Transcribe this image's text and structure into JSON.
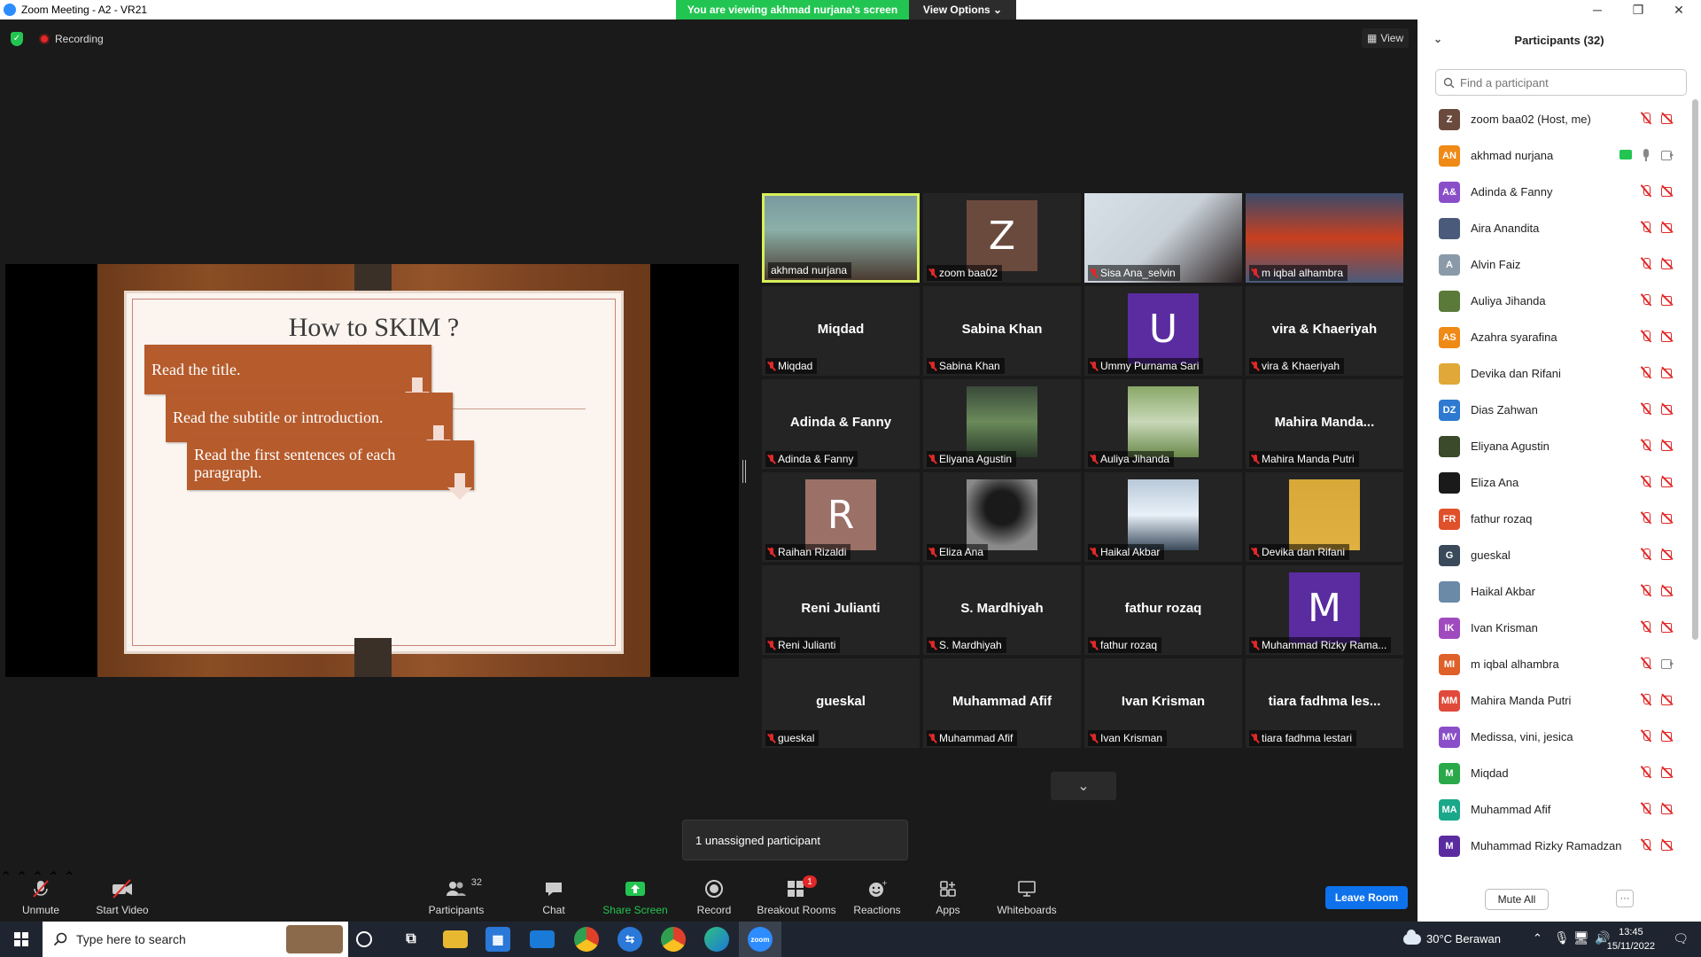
{
  "titlebar": {
    "title": "Zoom Meeting - A2 - VR21",
    "viewing_banner": "You are viewing akhmad nurjana's screen",
    "view_options": "View Options ⌄",
    "minimize": "─",
    "maximize": "❐",
    "close": "✕"
  },
  "meeting": {
    "recording_label": "Recording",
    "view_label": "View",
    "unassigned_popup": "1 unassigned participant",
    "gallery_next": "⌄"
  },
  "slide": {
    "title": "How to SKIM ?",
    "steps": [
      "Read the title.",
      "Read the subtitle or introduction.",
      "Read the first sentences of each paragraph."
    ]
  },
  "gallery": {
    "tiles": [
      {
        "label": "akhmad nurjana",
        "center": "",
        "avatar": "",
        "kind": "video"
      },
      {
        "label": "zoom baa02",
        "center": "",
        "avatar": "Z",
        "avatar_color": "#6b4a3e",
        "kind": "avatar"
      },
      {
        "label": "Sisa Ana_selvin",
        "center": "",
        "avatar": "",
        "kind": "video"
      },
      {
        "label": "m iqbal alhambra",
        "center": "",
        "avatar": "",
        "kind": "video"
      },
      {
        "label": "Miqdad",
        "center": "Miqdad",
        "kind": "name"
      },
      {
        "label": "Sabina Khan",
        "center": "Sabina Khan",
        "kind": "name"
      },
      {
        "label": "Ummy Purnama Sari",
        "center": "",
        "avatar": "U",
        "avatar_color": "#5a2ca0",
        "kind": "avatar"
      },
      {
        "label": "vira & Khaeriyah",
        "center": "vira & Khaeriyah",
        "kind": "name"
      },
      {
        "label": "Adinda & Fanny",
        "center": "Adinda & Fanny",
        "kind": "name"
      },
      {
        "label": "Eliyana Agustin",
        "center": "",
        "kind": "photo"
      },
      {
        "label": "Auliya Jihanda",
        "center": "",
        "kind": "photo"
      },
      {
        "label": "Mahira Manda Putri",
        "center": "Mahira  Manda...",
        "kind": "name"
      },
      {
        "label": "Raihan Rizaldi",
        "center": "",
        "avatar": "R",
        "avatar_color": "#9b7066",
        "kind": "avatar"
      },
      {
        "label": "Eliza Ana",
        "center": "",
        "kind": "photo"
      },
      {
        "label": "Haikal Akbar",
        "center": "",
        "kind": "photo"
      },
      {
        "label": "Devika dan Rifani",
        "center": "",
        "kind": "photo"
      },
      {
        "label": "Reni Julianti",
        "center": "Reni Julianti",
        "kind": "name"
      },
      {
        "label": "S. Mardhiyah",
        "center": "S. Mardhiyah",
        "kind": "name"
      },
      {
        "label": "fathur rozaq",
        "center": "fathur rozaq",
        "kind": "name"
      },
      {
        "label": "Muhammad Rizky Rama...",
        "center": "",
        "avatar": "M",
        "avatar_color": "#5a2ca0",
        "kind": "avatar"
      },
      {
        "label": "gueskal",
        "center": "gueskal",
        "kind": "name"
      },
      {
        "label": "Muhammad Afif",
        "center": "Muhammad Afif",
        "kind": "name"
      },
      {
        "label": "Ivan Krisman",
        "center": "Ivan Krisman",
        "kind": "name"
      },
      {
        "label": "tiara fadhma lestari",
        "center": "tiara fadhma les...",
        "kind": "name"
      }
    ]
  },
  "toolbar": {
    "unmute": "Unmute",
    "start_video": "Start Video",
    "participants": "Participants",
    "participants_count": "32",
    "chat": "Chat",
    "share_screen": "Share Screen",
    "record": "Record",
    "breakout_rooms": "Breakout Rooms",
    "breakout_badge": "1",
    "reactions": "Reactions",
    "apps": "Apps",
    "whiteboards": "Whiteboards",
    "leave_room": "Leave Room"
  },
  "panel": {
    "title": "Participants (32)",
    "search_placeholder": "Find a participant",
    "mute_all": "Mute All",
    "more": "···",
    "participants": [
      {
        "initials": "Z",
        "name": "zoom baa02 (Host, me)",
        "color": "#6b4a3e",
        "mic": "off",
        "cam": "off"
      },
      {
        "initials": "AN",
        "name": "akhmad nurjana",
        "color": "#f08a16",
        "mic": "on",
        "cam": "on",
        "sharing": true
      },
      {
        "initials": "A&",
        "name": "Adinda & Fanny",
        "color": "#8a4fc8",
        "mic": "off",
        "cam": "off"
      },
      {
        "initials": "",
        "name": "Aira Anandita",
        "color": "#4a5a7a",
        "mic": "off",
        "cam": "off"
      },
      {
        "initials": "A",
        "name": "Alvin Faiz",
        "color": "#8a9aa8",
        "mic": "off",
        "cam": "off"
      },
      {
        "initials": "",
        "name": "Auliya Jihanda",
        "color": "#5a7a3a",
        "mic": "off",
        "cam": "off"
      },
      {
        "initials": "AS",
        "name": "Azahra syarafina",
        "color": "#f08a16",
        "mic": "off",
        "cam": "off"
      },
      {
        "initials": "",
        "name": "Devika dan Rifani",
        "color": "#e0a838",
        "mic": "off",
        "cam": "off"
      },
      {
        "initials": "DZ",
        "name": "Dias Zahwan",
        "color": "#2d7ad0",
        "mic": "off",
        "cam": "off"
      },
      {
        "initials": "",
        "name": "Eliyana Agustin",
        "color": "#3a4a2a",
        "mic": "off",
        "cam": "off"
      },
      {
        "initials": "",
        "name": "Eliza Ana",
        "color": "#1a1a1a",
        "mic": "off",
        "cam": "off"
      },
      {
        "initials": "FR",
        "name": "fathur rozaq",
        "color": "#e0502a",
        "mic": "off",
        "cam": "off"
      },
      {
        "initials": "G",
        "name": "gueskal",
        "color": "#3a4a5a",
        "mic": "off",
        "cam": "off"
      },
      {
        "initials": "",
        "name": "Haikal Akbar",
        "color": "#6a8aa8",
        "mic": "off",
        "cam": "off"
      },
      {
        "initials": "IK",
        "name": "Ivan Krisman",
        "color": "#a04ac0",
        "mic": "off",
        "cam": "off"
      },
      {
        "initials": "MI",
        "name": "m iqbal alhambra",
        "color": "#e0602a",
        "mic": "off",
        "cam": "on"
      },
      {
        "initials": "MM",
        "name": "Mahira Manda Putri",
        "color": "#e04a3a",
        "mic": "off",
        "cam": "off"
      },
      {
        "initials": "MV",
        "name": "Medissa, vini, jesica",
        "color": "#8a4fc8",
        "mic": "off",
        "cam": "off"
      },
      {
        "initials": "M",
        "name": "Miqdad",
        "color": "#2aa84a",
        "mic": "off",
        "cam": "off"
      },
      {
        "initials": "MA",
        "name": "Muhammad Afif",
        "color": "#1aa88a",
        "mic": "off",
        "cam": "off"
      },
      {
        "initials": "M",
        "name": "Muhammad Rizky Ramadzan",
        "color": "#5a2ca0",
        "mic": "off",
        "cam": "off"
      }
    ]
  },
  "taskbar": {
    "search_placeholder": "Type here to search",
    "weather": "30°C  Berawan",
    "time": "13:45",
    "date": "15/11/2022"
  },
  "colors": {
    "share_green": "#23c552",
    "leave_blue": "#0e72ed",
    "muted_red": "#e02828",
    "active_speaker": "#d8f05a"
  }
}
